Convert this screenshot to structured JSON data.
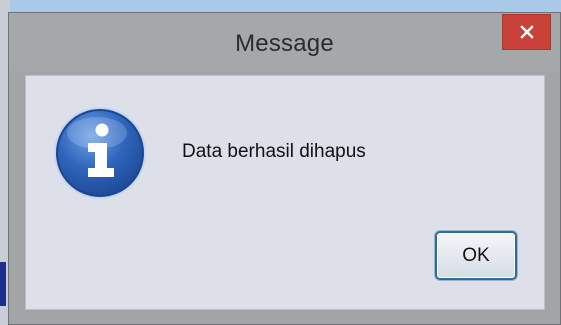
{
  "window": {
    "title": "Message",
    "close_icon": "close-icon"
  },
  "dialog": {
    "icon": "info-icon",
    "message": "Data berhasil dihapus",
    "ok_label": "OK"
  },
  "colors": {
    "close_button": "#c9423a",
    "titlebar": "#a5a8ab",
    "client_bg": "#dde0e8",
    "info_icon_blue": "#2e63b8",
    "ok_border": "#2c6f9b"
  }
}
